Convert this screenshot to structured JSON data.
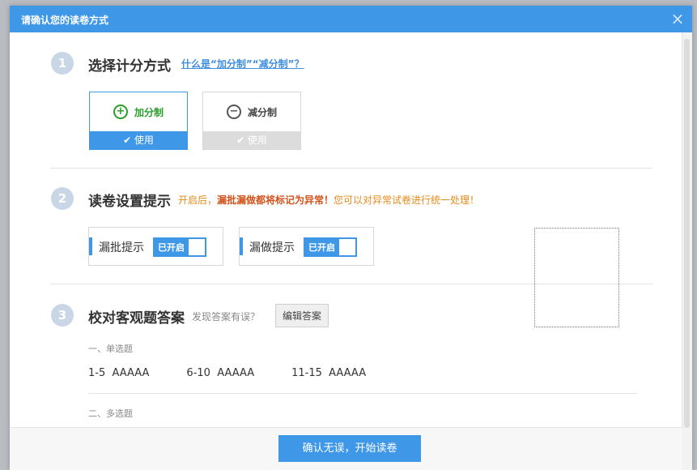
{
  "dialog": {
    "title": "请确认您的读卷方式",
    "close_symbol": "×"
  },
  "step1": {
    "number": "1",
    "title": "选择计分方式",
    "help_link": "什么是“加分制”“减分制”？",
    "options": [
      {
        "icon_symbol": "+",
        "label": "加分制",
        "bar_label": "✔ 使用",
        "active": true
      },
      {
        "icon_symbol": "−",
        "label": "减分制",
        "bar_label": "✔ 使用",
        "active": false
      }
    ]
  },
  "step2": {
    "number": "2",
    "title": "读卷设置提示",
    "tip_prefix": "开启后，",
    "tip_emphasis": "漏批漏做都将标记为异常！",
    "tip_suffix": "您可以对异常试卷进行统一处理！",
    "settings": [
      {
        "label": "漏批提示",
        "toggle_text": "已开启"
      },
      {
        "label": "漏做提示",
        "toggle_text": "已开启"
      }
    ]
  },
  "step3": {
    "number": "3",
    "title": "校对客观题答案",
    "hint": "发现答案有误？",
    "edit_button": "编辑答案",
    "sections": [
      {
        "label": "一、单选题",
        "answers": [
          {
            "range": "1-5",
            "value": "AAAAA"
          },
          {
            "range": "6-10",
            "value": "AAAAA"
          },
          {
            "range": "11-15",
            "value": "AAAAA"
          }
        ]
      },
      {
        "label": "二、多选题"
      }
    ]
  },
  "footer": {
    "confirm_button": "确认无误，开始读卷"
  }
}
